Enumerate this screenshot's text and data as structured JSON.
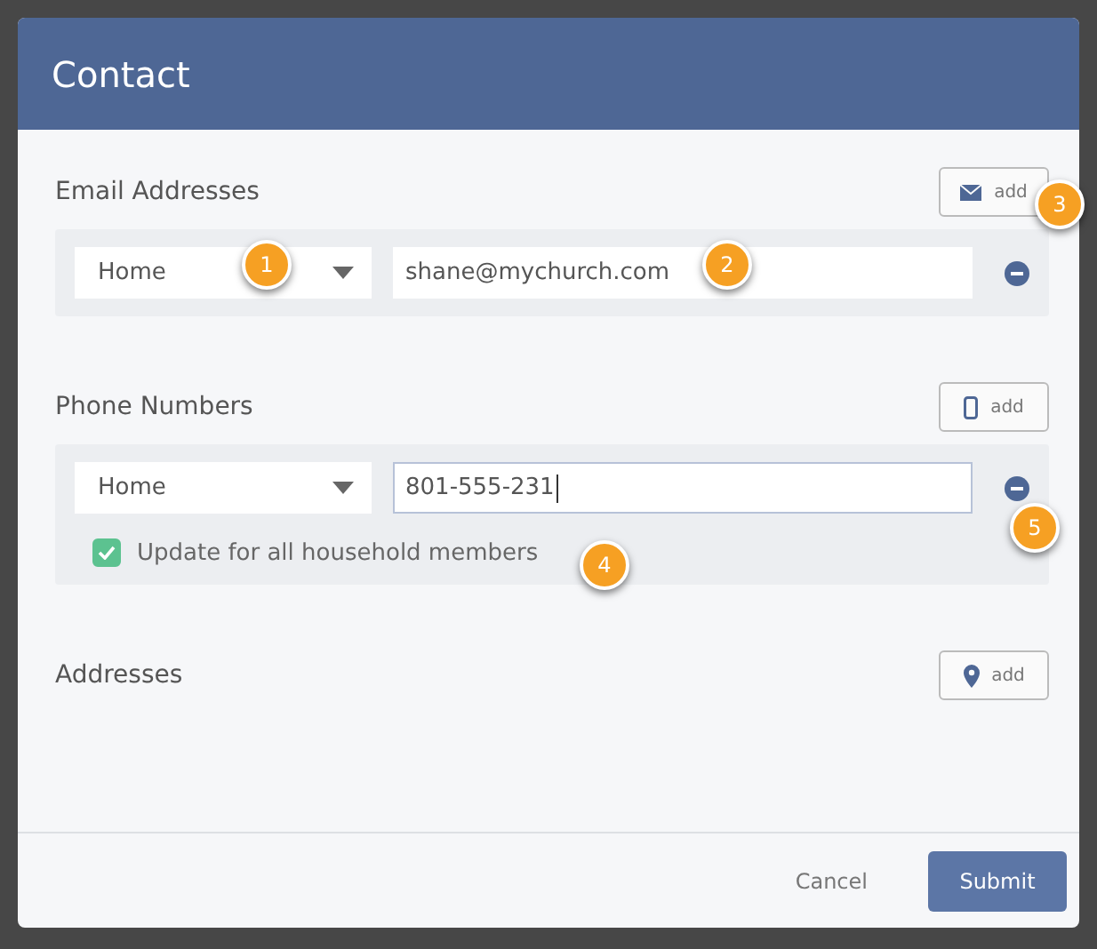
{
  "dialog": {
    "title": "Contact"
  },
  "sections": [
    {
      "kind": "email",
      "label": "Email Addresses",
      "add_label": "add",
      "entries": [
        {
          "type": "Home",
          "value": "shane@mychurch.com",
          "focused": false
        }
      ]
    },
    {
      "kind": "phone",
      "label": "Phone Numbers",
      "add_label": "add",
      "entries": [
        {
          "type": "Home",
          "value": "801-555-231",
          "focused": true
        }
      ],
      "update_all": {
        "label": "Update for all household members",
        "checked": true
      }
    },
    {
      "kind": "address",
      "label": "Addresses",
      "add_label": "add"
    }
  ],
  "footer": {
    "cancel": "Cancel",
    "submit": "Submit"
  },
  "callouts": [
    {
      "number": "1"
    },
    {
      "number": "2"
    },
    {
      "number": "3"
    },
    {
      "number": "4"
    },
    {
      "number": "5"
    }
  ]
}
